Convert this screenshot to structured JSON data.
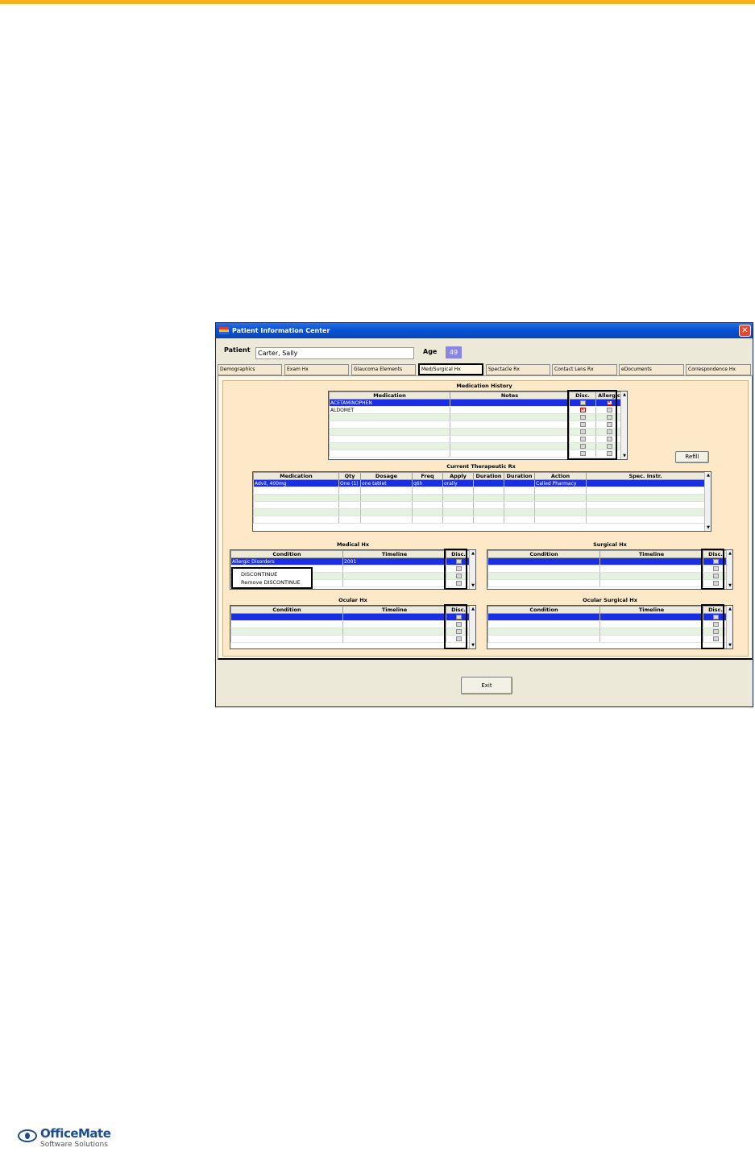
{
  "window": {
    "title": "Patient Information Center",
    "close_glyph": "✕"
  },
  "patient": {
    "label": "Patient",
    "name": "Carter, Sally",
    "age_label": "Age",
    "age": "49"
  },
  "tabs": [
    "Demographics",
    "Exam Hx",
    "Glaucoma Elements",
    "Med/Surgical Hx",
    "Spectacle Rx",
    "Contact Lens Rx",
    "eDocuments",
    "Correspondence Hx"
  ],
  "active_tab": "Med/Surgical Hx",
  "medication_history": {
    "title": "Medication History",
    "columns": [
      "Medication",
      "Notes",
      "Disc.",
      "Allergic"
    ],
    "rows": [
      {
        "medication": "ACETAMINOPHEN",
        "notes": "",
        "disc": false,
        "allergic": true,
        "selected": true
      },
      {
        "medication": "ALDOMET",
        "notes": "",
        "disc": true,
        "allergic": false,
        "selected": false
      },
      {
        "medication": "",
        "notes": "",
        "disc": false,
        "allergic": false
      },
      {
        "medication": "",
        "notes": "",
        "disc": false,
        "allergic": false
      },
      {
        "medication": "",
        "notes": "",
        "disc": false,
        "allergic": false
      },
      {
        "medication": "",
        "notes": "",
        "disc": false,
        "allergic": false
      },
      {
        "medication": "",
        "notes": "",
        "disc": false,
        "allergic": false
      },
      {
        "medication": "",
        "notes": "",
        "disc": false,
        "allergic": false
      }
    ]
  },
  "refill_button": "Refill",
  "current_rx": {
    "title": "Current Therapeutic Rx",
    "columns": [
      "Medication",
      "Qty",
      "Dosage",
      "Freq",
      "Apply",
      "Duration",
      "Duration",
      "Action",
      "Spec. Instr."
    ],
    "rows": [
      [
        "Advil, 400mg",
        "One (1)",
        "one tablet",
        "q6h",
        "orally",
        "",
        "",
        "Called Pharmacy",
        ""
      ],
      [
        "",
        "",
        "",
        "",
        "",
        "",
        "",
        "",
        ""
      ],
      [
        "",
        "",
        "",
        "",
        "",
        "",
        "",
        "",
        ""
      ],
      [
        "",
        "",
        "",
        "",
        "",
        "",
        "",
        "",
        ""
      ],
      [
        "",
        "",
        "",
        "",
        "",
        "",
        "",
        "",
        ""
      ],
      [
        "",
        "",
        "",
        "",
        "",
        "",
        "",
        "",
        ""
      ]
    ]
  },
  "medical_hx": {
    "title": "Medical Hx",
    "columns": [
      "Condition",
      "Timeline",
      "Disc."
    ],
    "rows": [
      [
        "Allergic Disorders",
        "2001"
      ],
      [
        "",
        ""
      ],
      [
        "",
        ""
      ],
      [
        "",
        ""
      ]
    ]
  },
  "surgical_hx": {
    "title": "Surgical Hx",
    "columns": [
      "Condition",
      "Timeline",
      "Disc."
    ],
    "rows": [
      [
        "",
        ""
      ],
      [
        "",
        ""
      ],
      [
        "",
        ""
      ],
      [
        "",
        ""
      ]
    ]
  },
  "ocular_hx": {
    "title": "Ocular Hx",
    "columns": [
      "Condition",
      "Timeline",
      "Disc."
    ],
    "rows": [
      [
        "",
        ""
      ],
      [
        "",
        ""
      ],
      [
        "",
        ""
      ],
      [
        "",
        ""
      ]
    ]
  },
  "ocular_surgical_hx": {
    "title": "Ocular Surgical Hx",
    "columns": [
      "Condition",
      "Timeline",
      "Disc."
    ],
    "rows": [
      [
        "",
        ""
      ],
      [
        "",
        ""
      ],
      [
        "",
        ""
      ],
      [
        "",
        ""
      ]
    ]
  },
  "context_menu": [
    "DISCONTINUE",
    "Remove DISCONTINUE"
  ],
  "exit_button": "Exit",
  "scroll": {
    "up": "▲",
    "down": "▼"
  },
  "logo": {
    "name": "OfficeMate",
    "subtitle": "Software Solutions"
  }
}
